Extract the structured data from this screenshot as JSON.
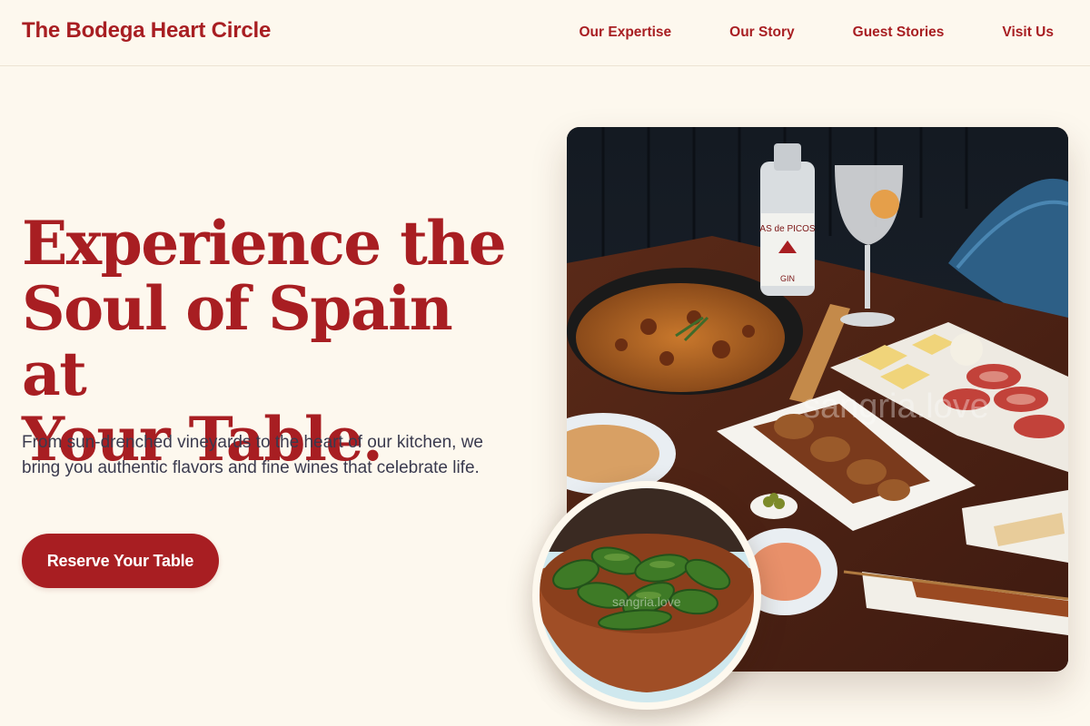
{
  "header": {
    "brand": "The Bodega Heart Circle",
    "nav": [
      "Our Expertise",
      "Our Story",
      "Guest Stories",
      "Visit Us"
    ]
  },
  "hero": {
    "title_lines": [
      "Experience the",
      "Soul of Spain at",
      "Your Table."
    ],
    "description": "From sun-drenched vineyards to the heart of our kitchen, we bring you authentic flavors and fine wines that celebrate life.",
    "cta_label": "Reserve Your Table"
  },
  "photo": {
    "watermark": "sangria.love",
    "bottle_label": "AS de PICOS",
    "bottle_sublabel": "GIN"
  },
  "inset": {
    "watermark": "sangria.love"
  },
  "colors": {
    "background": "#fdf8ee",
    "brand_red": "#a81e22",
    "body_text": "#3a3a4e"
  }
}
